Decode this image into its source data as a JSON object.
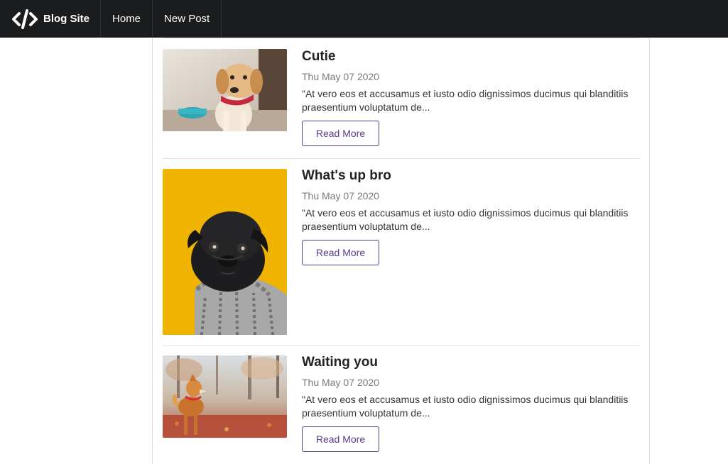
{
  "navbar": {
    "brand": "Blog Site",
    "items": [
      {
        "label": "Home"
      },
      {
        "label": "New Post"
      }
    ]
  },
  "posts": [
    {
      "title": "Cutie",
      "date": "Thu May 07 2020",
      "excerpt": "\"At vero eos et accusamus et iusto odio dignissimos ducimus qui blanditiis praesentium voluptatum de...",
      "button": "Read More",
      "image": "puppy-photo"
    },
    {
      "title": "What's up bro",
      "date": "Thu May 07 2020",
      "excerpt": "\"At vero eos et accusamus et iusto odio dignissimos ducimus qui blanditiis praesentium voluptatum de...",
      "button": "Read More",
      "image": "pug-photo"
    },
    {
      "title": "Waiting you",
      "date": "Thu May 07 2020",
      "excerpt": "\"At vero eos et accusamus et iusto odio dignissimos ducimus qui blanditiis praesentium voluptatum de...",
      "button": "Read More",
      "image": "shiba-photo"
    }
  ],
  "colors": {
    "navbar": "#1b1c1d",
    "accent": "#5b3a8f",
    "pug_background": "#f0b400"
  }
}
